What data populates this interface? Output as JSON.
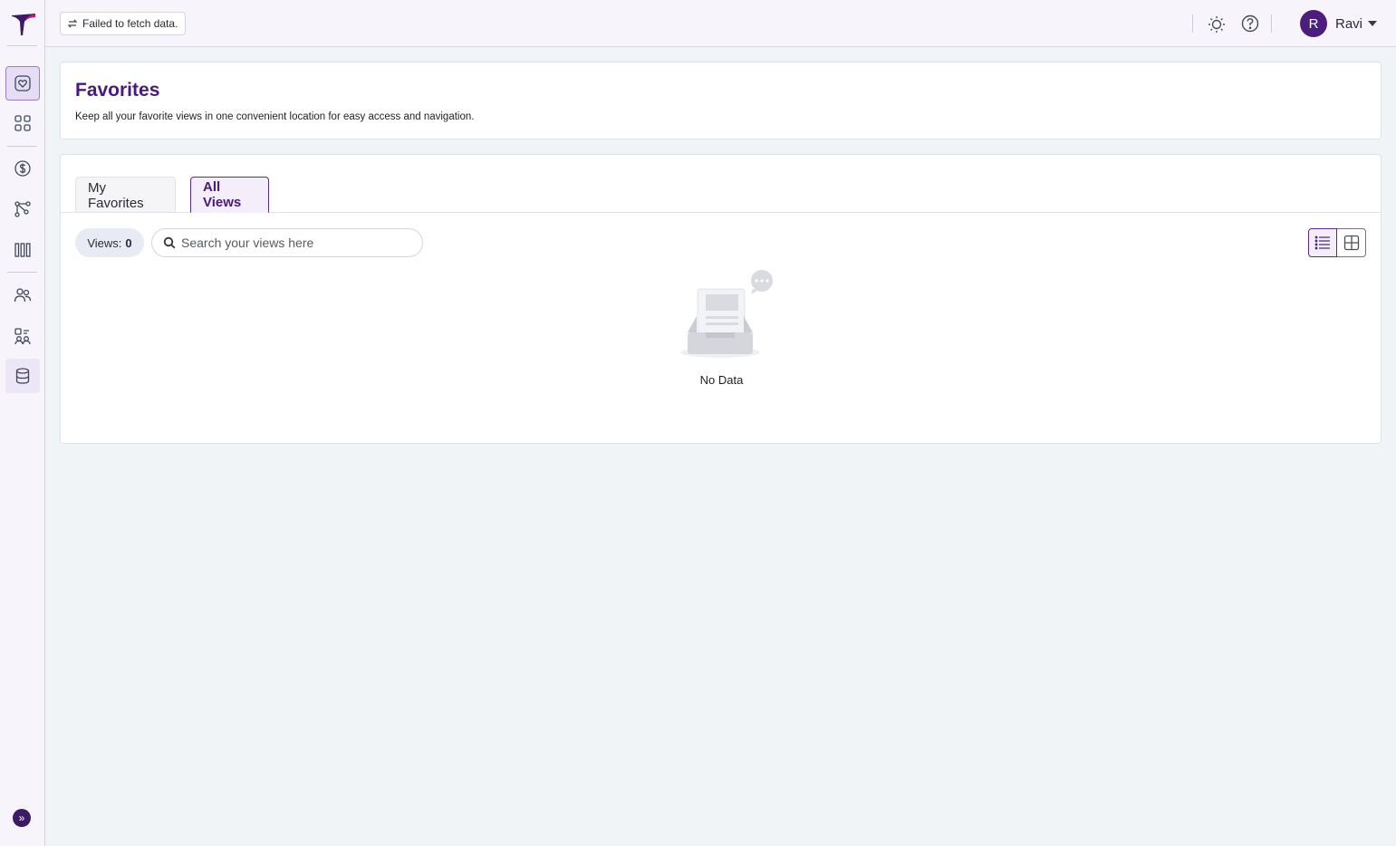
{
  "sidebar": {
    "items": [
      {
        "icon": "favorites-heart-icon",
        "active": true
      },
      {
        "icon": "grid-apps-icon"
      },
      {
        "icon": "dollar-icon"
      },
      {
        "icon": "flow-nodes-icon"
      },
      {
        "icon": "bar-columns-icon"
      },
      {
        "icon": "users-icon"
      },
      {
        "icon": "group-settings-icon"
      },
      {
        "icon": "database-icon",
        "soft": true
      }
    ],
    "expand_label": "»"
  },
  "topbar": {
    "fetch_message": "Failed to fetch data.",
    "user_initial": "R",
    "user_name": "Ravi"
  },
  "header": {
    "title": "Favorites",
    "description": "Keep all your favorite views in one convenient location for easy access and navigation."
  },
  "tabs": [
    {
      "label": "My Favorites",
      "active": false
    },
    {
      "label": "All Views",
      "active": true
    }
  ],
  "toolbar": {
    "views_label": "Views:",
    "views_count": "0",
    "search_placeholder": "Search your views here"
  },
  "empty_state": {
    "text": "No Data"
  },
  "colors": {
    "brand": "#4a1a7a",
    "avatar": "#4b1d7c",
    "background": "#f1f4f7"
  }
}
